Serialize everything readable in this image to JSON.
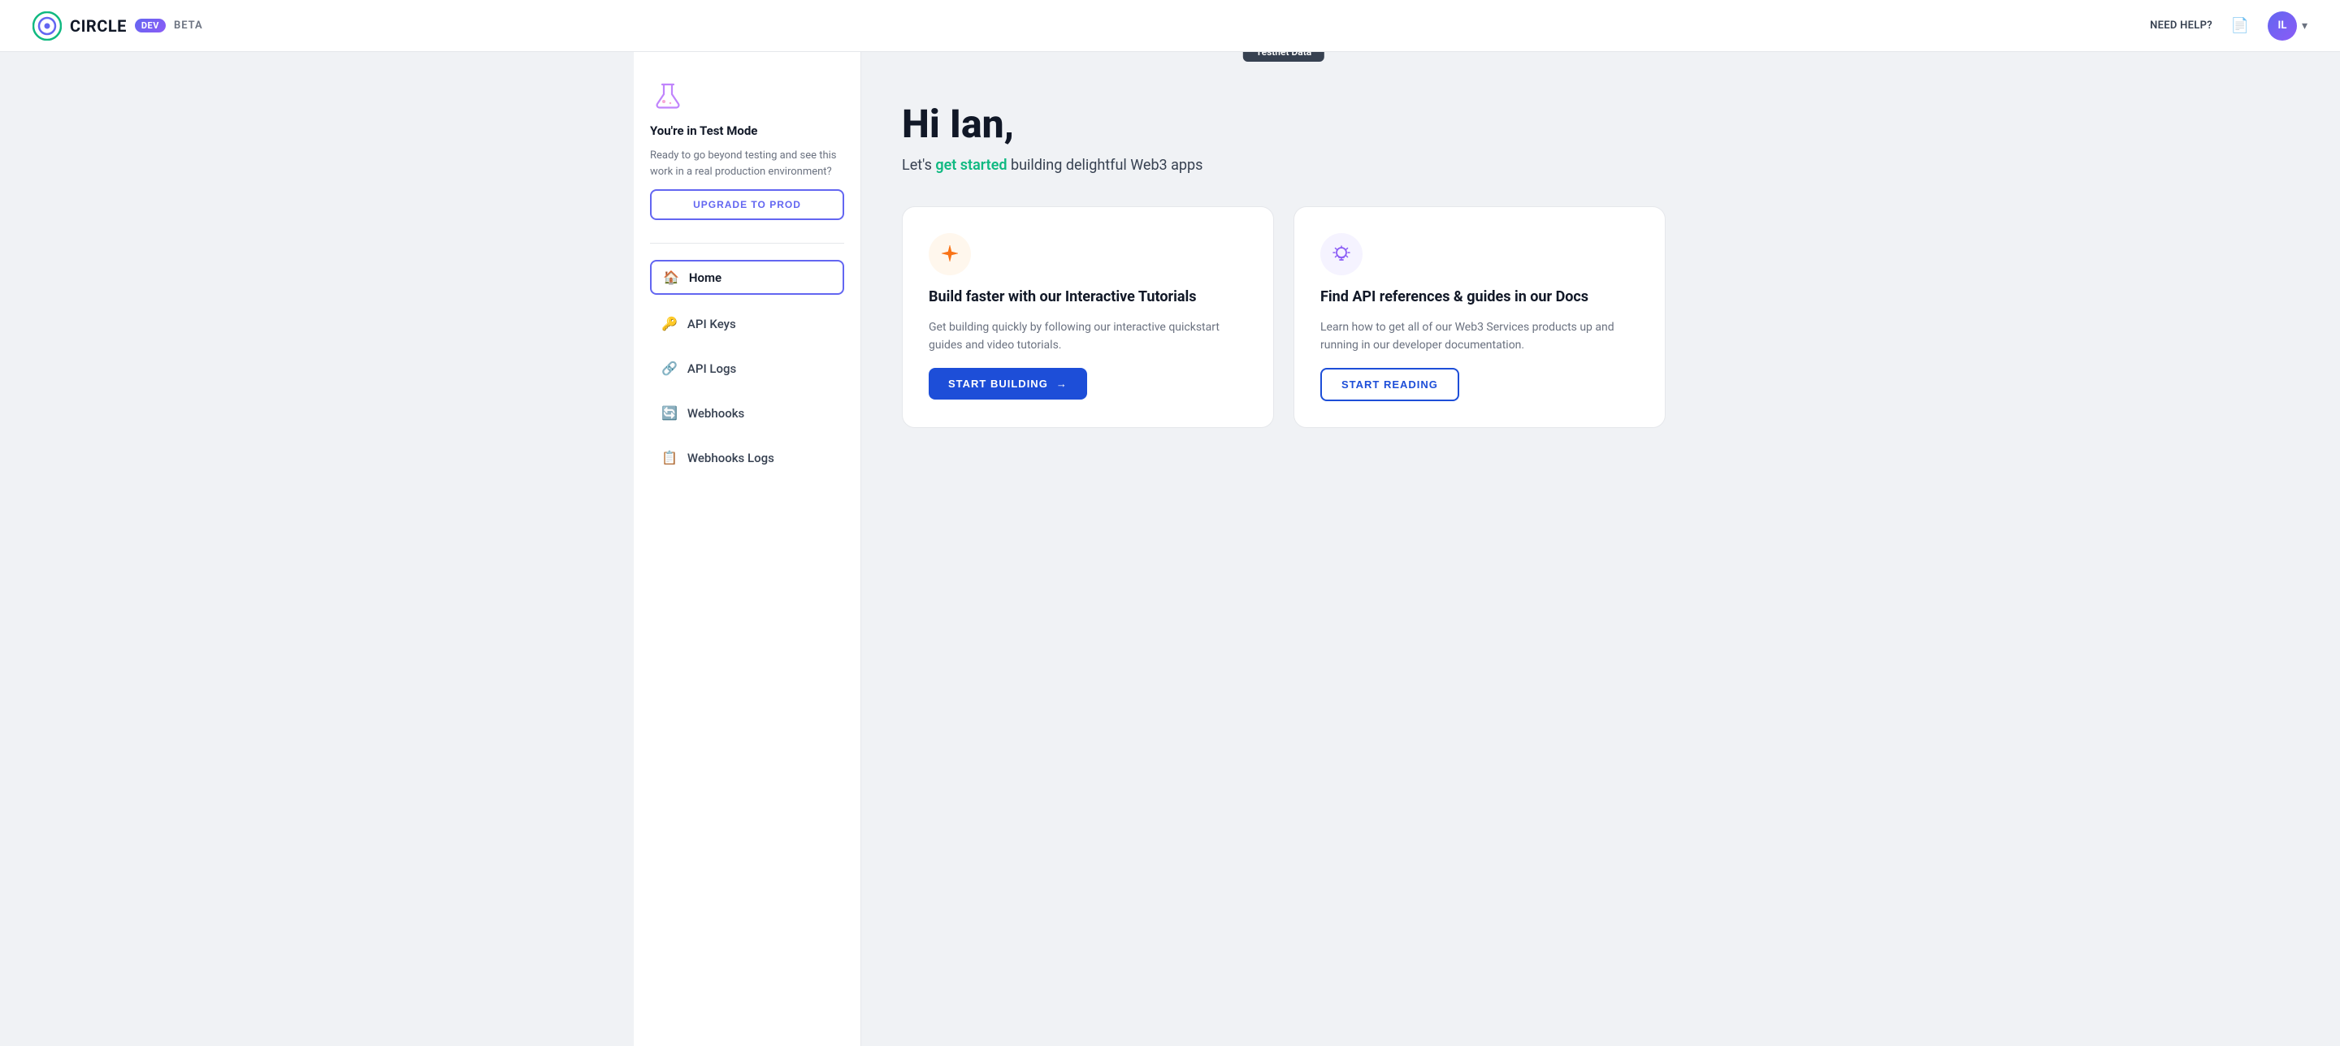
{
  "header": {
    "logo_text": "CIRCLE",
    "dev_badge": "DEV",
    "beta_text": "BETA",
    "need_help_label": "NEED HELP?",
    "avatar_initials": "IL",
    "doc_icon_label": "📄"
  },
  "sidebar": {
    "flask_emoji": "🧪",
    "test_mode_title": "You're in Test Mode",
    "test_mode_desc": "Ready to go beyond testing and see this work in a real production environment?",
    "upgrade_button_label": "UPGRADE TO PROD",
    "nav_items": [
      {
        "label": "Home",
        "icon": "🏠",
        "active": true
      },
      {
        "label": "API Keys",
        "icon": "🔑",
        "active": false
      },
      {
        "label": "API Logs",
        "icon": "🔗",
        "active": false
      },
      {
        "label": "Webhooks",
        "icon": "🔄",
        "active": false
      },
      {
        "label": "Webhooks Logs",
        "icon": "📋",
        "active": false
      }
    ]
  },
  "content": {
    "testnet_badge": "Testnet Data",
    "welcome_title": "Hi Ian,",
    "welcome_subtitle_before": "Let's ",
    "welcome_link": "get started",
    "welcome_subtitle_after": " building delightful Web3 apps",
    "cards": [
      {
        "icon": "✦",
        "icon_style": "orange",
        "title": "Build faster with our Interactive Tutorials",
        "description": "Get building quickly by following our interactive quickstart guides and video tutorials.",
        "button_label": "START BUILDING",
        "button_type": "primary",
        "button_arrow": "→"
      },
      {
        "icon": "💡",
        "icon_style": "purple",
        "title": "Find API references & guides in our Docs",
        "description": "Learn how to get all of our Web3 Services products up and running in our developer documentation.",
        "button_label": "START READING",
        "button_type": "outline",
        "button_arrow": ""
      }
    ]
  }
}
